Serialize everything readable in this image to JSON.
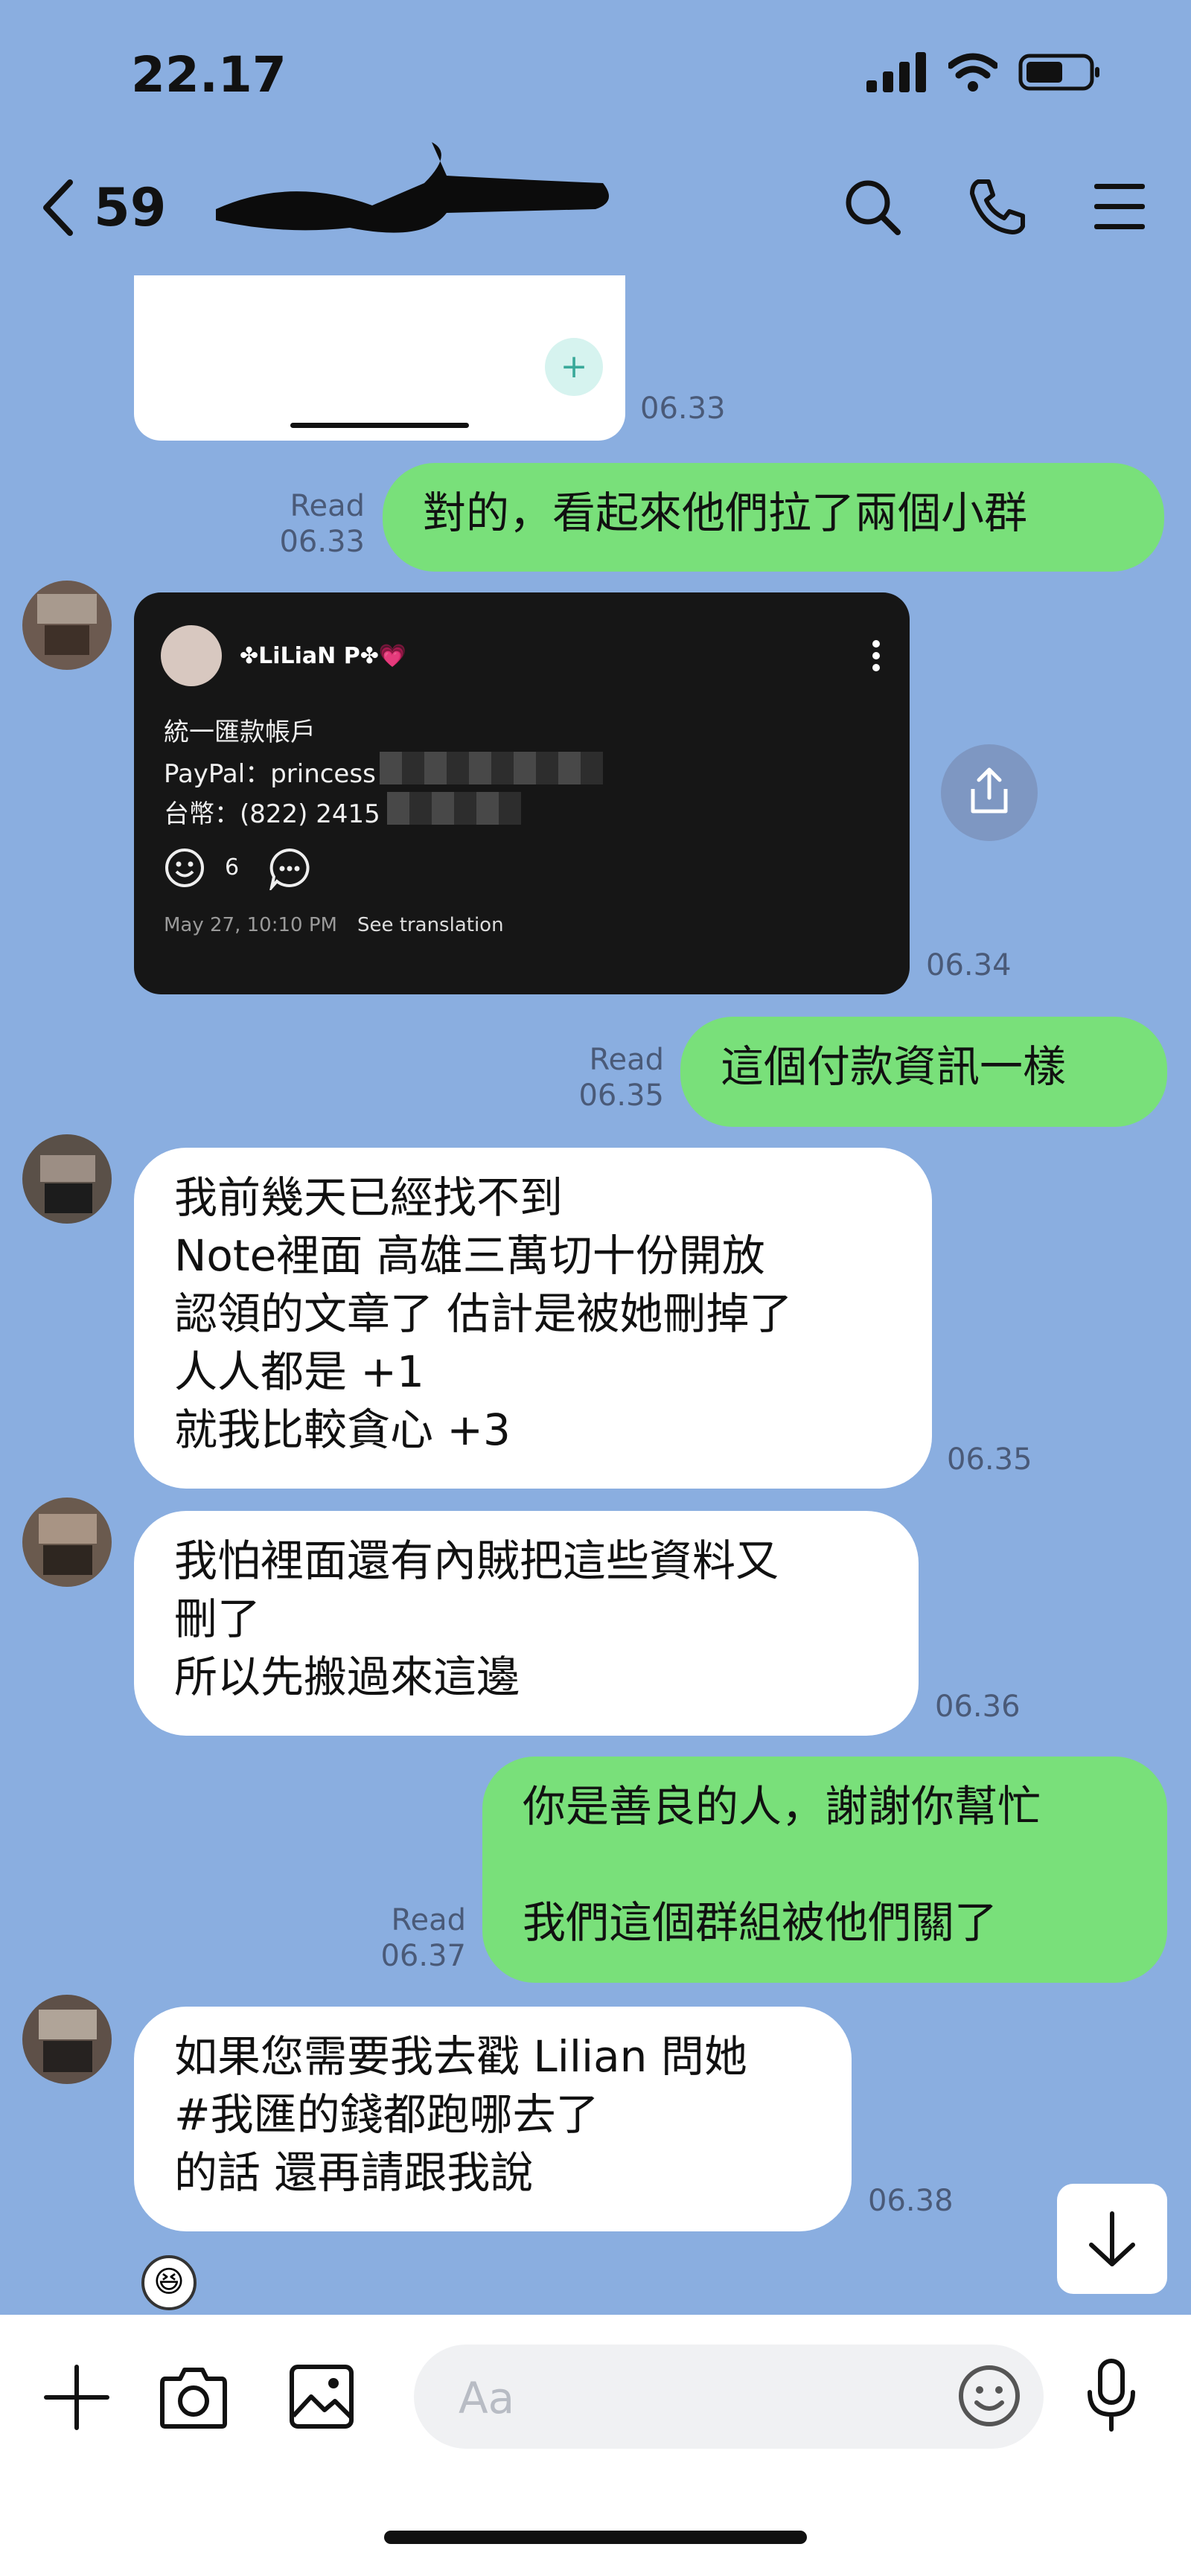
{
  "status": {
    "time": "22.17"
  },
  "header": {
    "back_count": "59"
  },
  "messages": {
    "top_time": "06.33",
    "m1": {
      "text": "對的，看起來他們拉了兩個小群",
      "read": "Read",
      "time": "06.33"
    },
    "card": {
      "name": "✤LiLiaN P✤💗",
      "line1": "統一匯款帳戶",
      "line2": "PayPal：princess",
      "line3": "台幣：(822) 2415",
      "reactions": "6",
      "meta": "May 27, 10:10 PM",
      "translate": "See translation",
      "time": "06.34"
    },
    "m2": {
      "text": "這個付款資訊一樣",
      "read": "Read",
      "time": "06.35"
    },
    "m3": {
      "text": "我前幾天已經找不到\nNote裡面 高雄三萬切十份開放\n認領的文章了 估計是被她刪掉了\n人人都是 +1\n就我比較貪心 +3",
      "time": "06.35"
    },
    "m4": {
      "text": "我怕裡面還有內賊把這些資料又\n刪了\n所以先搬過來這邊",
      "time": "06.36"
    },
    "m5": {
      "text": "你是善良的人，謝謝你幫忙\n\n我們這個群組被他們關了",
      "read": "Read",
      "time": "06.37"
    },
    "m6": {
      "text": "如果您需要我去戳 Lilian 問她\n#我匯的錢都跑哪去了\n的話 還再請跟我說",
      "time": "06.38"
    }
  },
  "input": {
    "placeholder": "Aa"
  },
  "colors": {
    "background": "#8aaee0",
    "outgoing": "#79e07a",
    "incoming": "#ffffff"
  }
}
